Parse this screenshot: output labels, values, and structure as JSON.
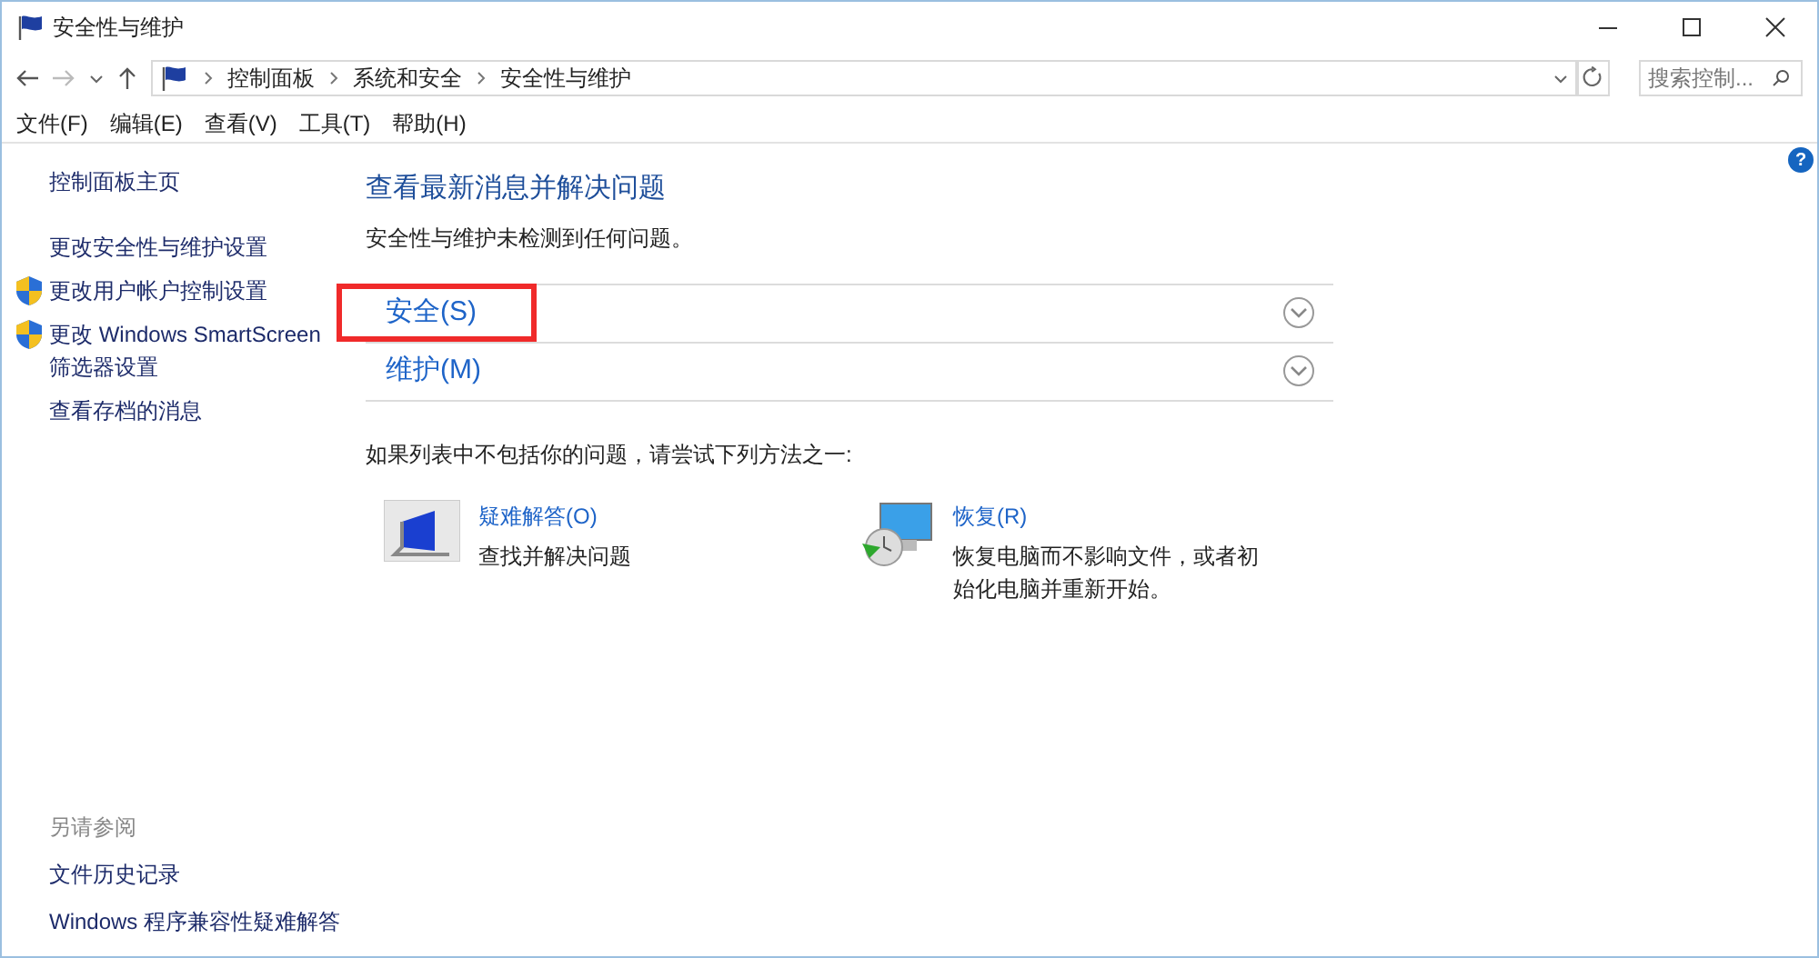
{
  "window": {
    "title": "安全性与维护"
  },
  "address": {
    "crumbs": [
      "控制面板",
      "系统和安全",
      "安全性与维护"
    ]
  },
  "search": {
    "placeholder": "搜索控制..."
  },
  "menu": [
    "文件(F)",
    "编辑(E)",
    "查看(V)",
    "工具(T)",
    "帮助(H)"
  ],
  "help": "?",
  "sidebar": {
    "items": [
      {
        "label": "控制面板主页",
        "kind": "link"
      },
      {
        "label": "更改安全性与维护设置",
        "kind": "link"
      },
      {
        "label": "更改用户帐户控制设置",
        "kind": "shield"
      },
      {
        "label": "更改 Windows SmartScreen 筛选器设置",
        "kind": "shield"
      },
      {
        "label": "查看存档的消息",
        "kind": "link"
      }
    ],
    "see_also": {
      "title": "另请参阅",
      "items": [
        "文件历史记录",
        "Windows 程序兼容性疑难解答"
      ]
    }
  },
  "main": {
    "title": "查看最新消息并解决问题",
    "status": "安全性与维护未检测到任何问题。",
    "sections": [
      {
        "label": "安全(S)",
        "expanded": false,
        "highlighted": true
      },
      {
        "label": "维护(M)",
        "expanded": false,
        "highlighted": false
      }
    ],
    "hint": "如果列表中不包括你的问题，请尝试下列方法之一:",
    "options": [
      {
        "kind": "troubleshoot",
        "title": "疑难解答(O)",
        "description": "查找并解决问题"
      },
      {
        "kind": "recovery",
        "title": "恢复(R)",
        "description": "恢复电脑而不影响文件，或者初始化电脑并重新开始。"
      }
    ]
  }
}
